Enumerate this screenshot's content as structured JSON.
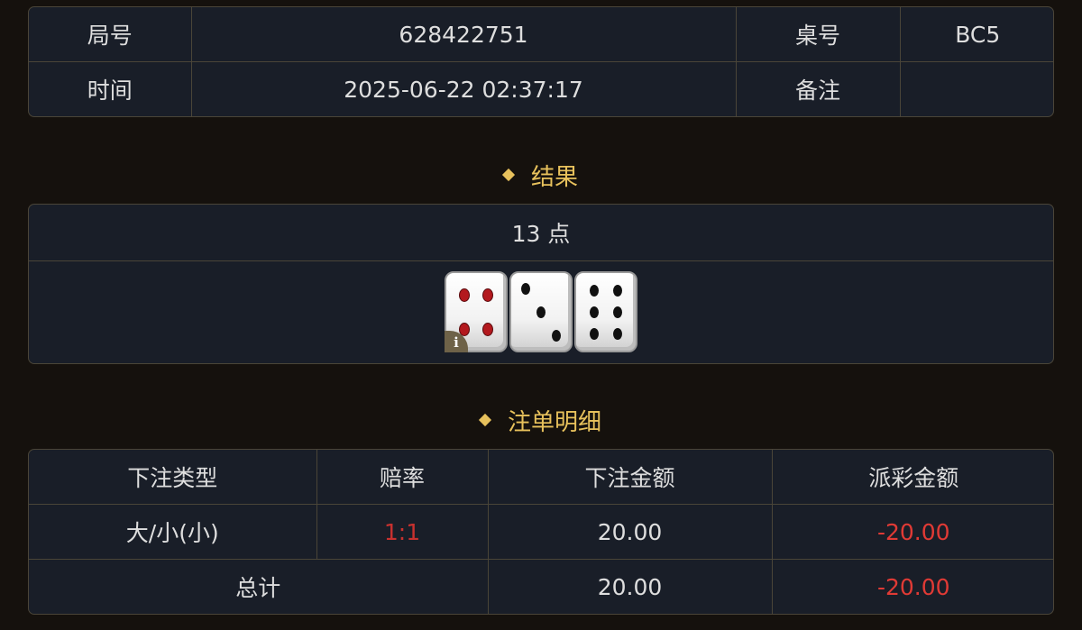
{
  "info": {
    "round_label": "局号",
    "round_value": "628422751",
    "table_label": "桌号",
    "table_value": "BC5",
    "time_label": "时间",
    "time_value": "2025-06-22 02:37:17",
    "remark_label": "备注",
    "remark_value": ""
  },
  "result": {
    "section_title": "结果",
    "points_text": "13 点",
    "dice": [
      4,
      3,
      6
    ],
    "info_badge": "i"
  },
  "bets": {
    "section_title": "注单明细",
    "headers": [
      "下注类型",
      "赔率",
      "下注金额",
      "派彩金额"
    ],
    "rows": [
      {
        "type": "大/小(小)",
        "odds": "1:1",
        "amount": "20.00",
        "payout": "-20.00"
      }
    ],
    "total_label": "总计",
    "total_amount": "20.00",
    "total_payout": "-20.00"
  },
  "colors": {
    "accent_gold": "#e7c15c",
    "negative_red": "#e03a35",
    "panel_bg": "#191e28",
    "border": "#4a4538",
    "page_bg": "#15110d"
  }
}
